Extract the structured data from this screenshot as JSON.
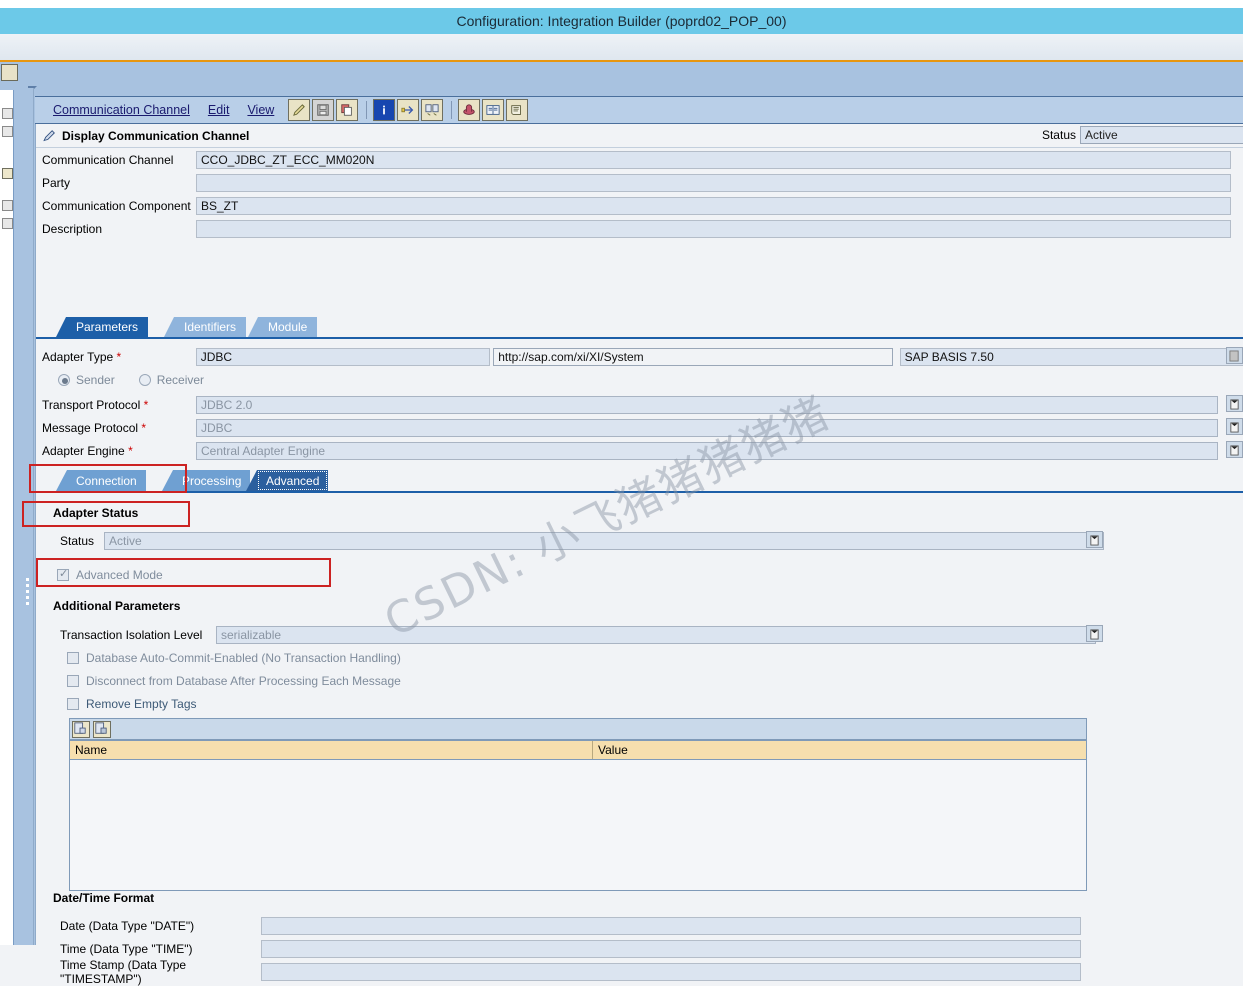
{
  "window": {
    "title": "Configuration: Integration Builder (poprd02_POP_00)"
  },
  "menubar": {
    "items": [
      {
        "label": "Communication Channel",
        "accel": "C"
      },
      {
        "label": "Edit",
        "accel": "d"
      },
      {
        "label": "View",
        "accel": "V"
      }
    ],
    "toolbar_groups": [
      {
        "buttons": [
          {
            "name": "edit-pencil-icon",
            "glyph": "✎",
            "style": "tan"
          },
          {
            "name": "save-icon",
            "glyph": "▤",
            "style": "gray"
          },
          {
            "name": "copy-icon",
            "glyph": "❐",
            "style": "tan"
          }
        ]
      },
      {
        "buttons": [
          {
            "name": "info-icon",
            "glyph": "i",
            "style": "blue"
          },
          {
            "name": "where-used-icon",
            "glyph": "⇹",
            "style": "tan"
          },
          {
            "name": "compare-icon",
            "glyph": "⧉",
            "style": "tan"
          }
        ]
      },
      {
        "buttons": [
          {
            "name": "history-icon",
            "glyph": "⬒",
            "style": "tan"
          },
          {
            "name": "documentation-icon",
            "glyph": "▦",
            "style": "tan"
          },
          {
            "name": "log-icon",
            "glyph": "☰",
            "style": "tan"
          }
        ]
      }
    ]
  },
  "panel": {
    "title": "Display Communication Channel",
    "status_label": "Status",
    "status_value": "Active"
  },
  "header_fields": [
    {
      "label": "Communication Channel",
      "value": "CCO_JDBC_ZT_ECC_MM020N",
      "state": "readonly"
    },
    {
      "label": "Party",
      "value": "",
      "state": "readonly"
    },
    {
      "label": "Communication Component",
      "value": "BS_ZT",
      "state": "readonly"
    },
    {
      "label": "Description",
      "value": "",
      "state": "readonly"
    }
  ],
  "main_tabs": [
    {
      "label": "Parameters",
      "active": true
    },
    {
      "label": "Identifiers",
      "active": false
    },
    {
      "label": "Module",
      "active": false
    }
  ],
  "adapter": {
    "type_label": "Adapter Type",
    "type_value": "JDBC",
    "namespace_value": "http://sap.com/xi/XI/System",
    "swcv_value": "SAP BASIS 7.50",
    "direction": [
      {
        "label": "Sender",
        "selected": true
      },
      {
        "label": "Receiver",
        "selected": false
      }
    ],
    "rows": [
      {
        "label": "Transport Protocol",
        "value": "JDBC 2.0",
        "required": true
      },
      {
        "label": "Message Protocol",
        "value": "JDBC",
        "required": true
      },
      {
        "label": "Adapter Engine",
        "value": "Central Adapter Engine",
        "required": true
      }
    ]
  },
  "sub_tabs": [
    {
      "label": "Connection",
      "active": false
    },
    {
      "label": "Processing",
      "active": false
    },
    {
      "label": "Advanced",
      "active": true
    }
  ],
  "adapter_status": {
    "section_title": "Adapter Status",
    "status_label": "Status",
    "status_value": "Active",
    "advanced_mode_label": "Advanced Mode",
    "advanced_mode_checked": true
  },
  "additional_parameters": {
    "section_title": "Additional Parameters",
    "isolation_label": "Transaction Isolation Level",
    "isolation_value": "serializable",
    "checkboxes": [
      {
        "label": "Database Auto-Commit-Enabled (No Transaction Handling)",
        "checked": false
      },
      {
        "label": "Disconnect from Database After Processing Each Message",
        "checked": false
      },
      {
        "label": "Remove Empty Tags",
        "checked": false
      }
    ],
    "table": {
      "columns": [
        "Name",
        "Value"
      ],
      "rows": []
    }
  },
  "datetime_format": {
    "section_title": "Date/Time Format",
    "rows": [
      {
        "label": "Date (Data Type \"DATE\")",
        "value": ""
      },
      {
        "label": "Time (Data Type \"TIME\")",
        "value": ""
      },
      {
        "label": "Time Stamp (Data Type \"TIMESTAMP\")",
        "value": ""
      }
    ]
  },
  "watermark": {
    "line1": "CSDN: 小飞猪猪猪猪猪"
  },
  "colors": {
    "titlebar": "#6cc9e8",
    "accent_rule": "#e8960f",
    "tab_active": "#1d5fa8",
    "tab_idle": "#8fb4dc",
    "annotation": "#cc2222",
    "table_header": "#f6dfae",
    "field_bg": "#dbe4f0"
  }
}
